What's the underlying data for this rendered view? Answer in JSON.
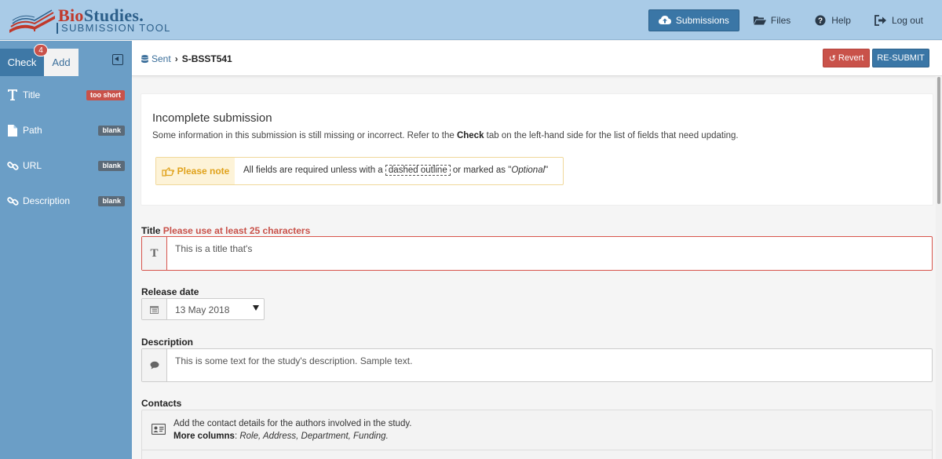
{
  "app": {
    "logo_prefix": "Bio",
    "logo_suffix": "Studies.",
    "logo_subtitle": "SUBMISSION TOOL"
  },
  "nav": {
    "submissions": "Submissions",
    "files": "Files",
    "help": "Help",
    "logout": "Log out"
  },
  "sidebar": {
    "tab_check": "Check",
    "tab_add": "Add",
    "badge_count": "4",
    "items": [
      {
        "label": "Title",
        "badge": "too short",
        "icon": "text-icon"
      },
      {
        "label": "Path",
        "badge": "blank",
        "icon": "file-icon"
      },
      {
        "label": "URL",
        "badge": "blank",
        "icon": "link-icon"
      },
      {
        "label": "Description",
        "badge": "blank",
        "icon": "link-icon"
      }
    ]
  },
  "breadcrumb": {
    "sent": "Sent",
    "id": "S-BSST541"
  },
  "actions": {
    "revert": "Revert",
    "resubmit": "RE-SUBMIT"
  },
  "notice": {
    "title": "Incomplete submission",
    "text_before": "Some information in this submission is still missing or incorrect. Refer to the ",
    "text_bold": "Check",
    "text_after": " tab on the left-hand side for the list of fields that need updating.",
    "please_note": "Please note",
    "note_before": "All fields are required unless with a ",
    "note_dashed": "dashed outline",
    "note_middle": " or marked as \"",
    "note_optional": "Optional",
    "note_end": "\""
  },
  "fields": {
    "title_label": "Title",
    "title_error": "Please use at least 25 characters",
    "title_value": "This is a title that's",
    "release_label": "Release date",
    "release_value": "13 May 2018",
    "description_label": "Description",
    "description_value": "This is some text for the study's description. Sample text.",
    "contacts_label": "Contacts",
    "contacts_text": "Add the contact details for the authors involved in the study.",
    "contacts_more_label": "More columns",
    "contacts_more_values": "Role, Address, Department, Funding."
  },
  "colors": {
    "header_bg": "#a9cbe7",
    "sidebar_bg": "#6b9ec6",
    "primary": "#3a76a6",
    "danger": "#c9524a",
    "warning": "#e0a21b"
  }
}
